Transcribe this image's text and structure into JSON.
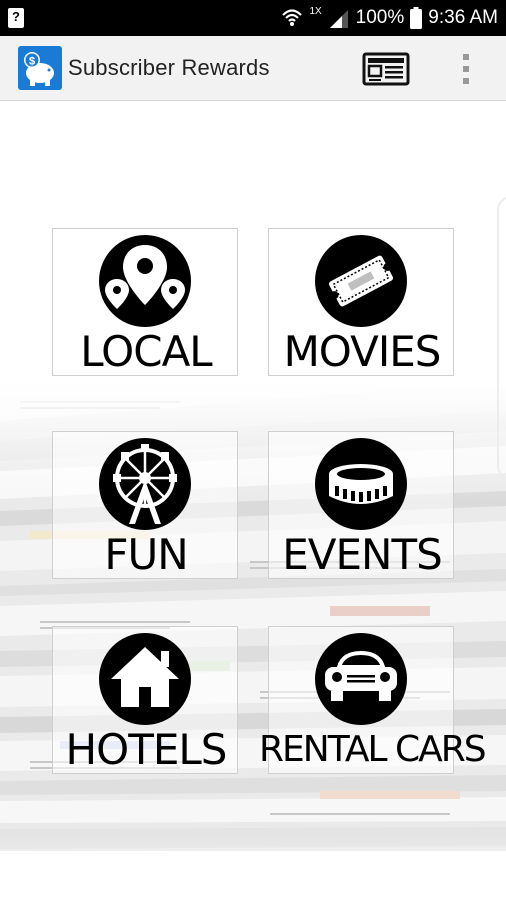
{
  "status_bar": {
    "left_icon": "?",
    "battery_pct": "100%",
    "time": "9:36 AM",
    "network": "1X"
  },
  "app_bar": {
    "title": "Subscriber Rewards",
    "app_icon": "piggy-bank-icon",
    "actions": [
      "newspaper-icon",
      "overflow-menu-icon"
    ]
  },
  "tiles": [
    {
      "label": "LOCAL",
      "icon": "map-pins-icon"
    },
    {
      "label": "MOVIES",
      "icon": "ticket-icon"
    },
    {
      "label": "FUN",
      "icon": "ferris-wheel-icon"
    },
    {
      "label": "EVENTS",
      "icon": "stadium-icon"
    },
    {
      "label": "HOTELS",
      "icon": "house-icon"
    },
    {
      "label": "RENTAL CARS",
      "icon": "car-icon"
    }
  ],
  "colors": {
    "status_bar_bg": "#000000",
    "app_bar_bg": "#f2f2f2",
    "app_icon_bg": "#1a7bd6",
    "icon_circle": "#000000"
  }
}
